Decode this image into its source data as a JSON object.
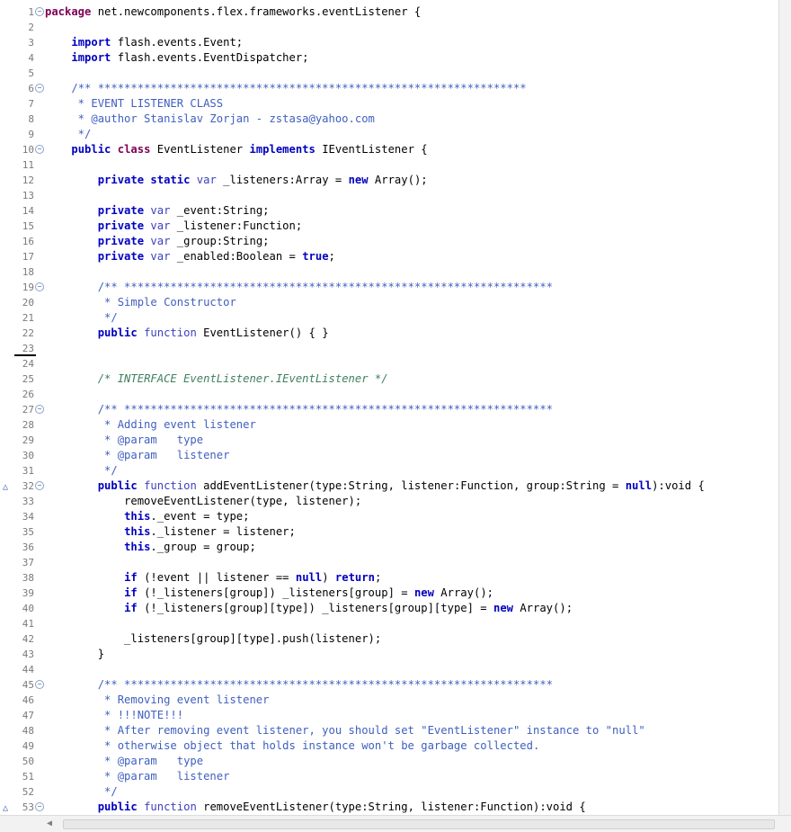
{
  "editor": {
    "lines": [
      {
        "n": "1",
        "fold": true,
        "t": [
          {
            "s": "package",
            "c": "kw"
          },
          {
            "s": " net.newcomponents.flex.frameworks.eventListener {"
          }
        ]
      },
      {
        "n": "2",
        "t": []
      },
      {
        "n": "3",
        "t": [
          {
            "s": "    "
          },
          {
            "s": "import",
            "c": "kb"
          },
          {
            "s": " flash.events.Event;"
          }
        ]
      },
      {
        "n": "4",
        "t": [
          {
            "s": "    "
          },
          {
            "s": "import",
            "c": "kb"
          },
          {
            "s": " flash.events.EventDispatcher;"
          }
        ]
      },
      {
        "n": "5",
        "t": []
      },
      {
        "n": "6",
        "fold": true,
        "t": [
          {
            "s": "    "
          },
          {
            "s": "/** *****************************************************************",
            "c": "cm"
          }
        ]
      },
      {
        "n": "7",
        "t": [
          {
            "s": "     * EVENT LISTENER CLASS",
            "c": "cm"
          }
        ]
      },
      {
        "n": "8",
        "t": [
          {
            "s": "     * @author Stanislav Zorjan - zstasa@yahoo.com",
            "c": "cm"
          }
        ]
      },
      {
        "n": "9",
        "t": [
          {
            "s": "     */",
            "c": "cm"
          }
        ]
      },
      {
        "n": "10",
        "fold": true,
        "t": [
          {
            "s": "    "
          },
          {
            "s": "public",
            "c": "kb"
          },
          {
            "s": " "
          },
          {
            "s": "class",
            "c": "kw"
          },
          {
            "s": " EventListener "
          },
          {
            "s": "implements",
            "c": "kb"
          },
          {
            "s": " IEventListener {"
          }
        ]
      },
      {
        "n": "11",
        "t": []
      },
      {
        "n": "12",
        "t": [
          {
            "s": "        "
          },
          {
            "s": "private",
            "c": "kb"
          },
          {
            "s": " "
          },
          {
            "s": "static",
            "c": "kb"
          },
          {
            "s": " "
          },
          {
            "s": "var",
            "c": "ty"
          },
          {
            "s": " _listeners:Array = "
          },
          {
            "s": "new",
            "c": "kb"
          },
          {
            "s": " Array();"
          }
        ]
      },
      {
        "n": "13",
        "t": []
      },
      {
        "n": "14",
        "t": [
          {
            "s": "        "
          },
          {
            "s": "private",
            "c": "kb"
          },
          {
            "s": " "
          },
          {
            "s": "var",
            "c": "ty"
          },
          {
            "s": " _event:String;"
          }
        ]
      },
      {
        "n": "15",
        "t": [
          {
            "s": "        "
          },
          {
            "s": "private",
            "c": "kb"
          },
          {
            "s": " "
          },
          {
            "s": "var",
            "c": "ty"
          },
          {
            "s": " _listener:Function;"
          }
        ]
      },
      {
        "n": "16",
        "t": [
          {
            "s": "        "
          },
          {
            "s": "private",
            "c": "kb"
          },
          {
            "s": " "
          },
          {
            "s": "var",
            "c": "ty"
          },
          {
            "s": " _group:String;"
          }
        ]
      },
      {
        "n": "17",
        "t": [
          {
            "s": "        "
          },
          {
            "s": "private",
            "c": "kb"
          },
          {
            "s": " "
          },
          {
            "s": "var",
            "c": "ty"
          },
          {
            "s": " _enabled:Boolean = "
          },
          {
            "s": "true",
            "c": "kb"
          },
          {
            "s": ";"
          }
        ]
      },
      {
        "n": "18",
        "t": []
      },
      {
        "n": "19",
        "fold": true,
        "t": [
          {
            "s": "        "
          },
          {
            "s": "/** *****************************************************************",
            "c": "cm"
          }
        ]
      },
      {
        "n": "20",
        "t": [
          {
            "s": "         * Simple Constructor",
            "c": "cm"
          }
        ]
      },
      {
        "n": "21",
        "t": [
          {
            "s": "         */",
            "c": "cm"
          }
        ]
      },
      {
        "n": "22",
        "t": [
          {
            "s": "        "
          },
          {
            "s": "public",
            "c": "kb"
          },
          {
            "s": " "
          },
          {
            "s": "function",
            "c": "ty"
          },
          {
            "s": " EventListener() { }"
          }
        ]
      },
      {
        "n": "23",
        "t": []
      },
      {
        "n": "24",
        "cursor": true,
        "t": []
      },
      {
        "n": "25",
        "t": [
          {
            "s": "        "
          },
          {
            "s": "/* INTERFACE EventListener.IEventListener */",
            "c": "cg"
          }
        ]
      },
      {
        "n": "26",
        "t": []
      },
      {
        "n": "27",
        "fold": true,
        "t": [
          {
            "s": "        "
          },
          {
            "s": "/** *****************************************************************",
            "c": "cm"
          }
        ]
      },
      {
        "n": "28",
        "t": [
          {
            "s": "         * Adding event listener",
            "c": "cm"
          }
        ]
      },
      {
        "n": "29",
        "t": [
          {
            "s": "         * @param   type",
            "c": "cm"
          }
        ]
      },
      {
        "n": "30",
        "t": [
          {
            "s": "         * @param   listener",
            "c": "cm"
          }
        ]
      },
      {
        "n": "31",
        "t": [
          {
            "s": "         */",
            "c": "cm"
          }
        ]
      },
      {
        "n": "32",
        "fold": true,
        "override": true,
        "t": [
          {
            "s": "        "
          },
          {
            "s": "public",
            "c": "kb"
          },
          {
            "s": " "
          },
          {
            "s": "function",
            "c": "ty"
          },
          {
            "s": " addEventListener(type:String, listener:Function, group:String = "
          },
          {
            "s": "null",
            "c": "kb"
          },
          {
            "s": "):void {"
          }
        ]
      },
      {
        "n": "33",
        "t": [
          {
            "s": "            removeEventListener(type, listener);"
          }
        ]
      },
      {
        "n": "34",
        "t": [
          {
            "s": "            "
          },
          {
            "s": "this",
            "c": "kb"
          },
          {
            "s": "._event = type;"
          }
        ]
      },
      {
        "n": "35",
        "t": [
          {
            "s": "            "
          },
          {
            "s": "this",
            "c": "kb"
          },
          {
            "s": "._listener = listener;"
          }
        ]
      },
      {
        "n": "36",
        "t": [
          {
            "s": "            "
          },
          {
            "s": "this",
            "c": "kb"
          },
          {
            "s": "._group = group;"
          }
        ]
      },
      {
        "n": "37",
        "t": []
      },
      {
        "n": "38",
        "t": [
          {
            "s": "            "
          },
          {
            "s": "if",
            "c": "kb"
          },
          {
            "s": " (!event || listener == "
          },
          {
            "s": "null",
            "c": "kb"
          },
          {
            "s": ") "
          },
          {
            "s": "return",
            "c": "kb"
          },
          {
            "s": ";"
          }
        ]
      },
      {
        "n": "39",
        "t": [
          {
            "s": "            "
          },
          {
            "s": "if",
            "c": "kb"
          },
          {
            "s": " (!_listeners[group]) _listeners[group] = "
          },
          {
            "s": "new",
            "c": "kb"
          },
          {
            "s": " Array();"
          }
        ]
      },
      {
        "n": "40",
        "t": [
          {
            "s": "            "
          },
          {
            "s": "if",
            "c": "kb"
          },
          {
            "s": " (!_listeners[group][type]) _listeners[group][type] = "
          },
          {
            "s": "new",
            "c": "kb"
          },
          {
            "s": " Array();"
          }
        ]
      },
      {
        "n": "41",
        "t": []
      },
      {
        "n": "42",
        "t": [
          {
            "s": "            _listeners[group][type].push(listener);"
          }
        ]
      },
      {
        "n": "43",
        "t": [
          {
            "s": "        }"
          }
        ]
      },
      {
        "n": "44",
        "t": []
      },
      {
        "n": "45",
        "fold": true,
        "t": [
          {
            "s": "        "
          },
          {
            "s": "/** *****************************************************************",
            "c": "cm"
          }
        ]
      },
      {
        "n": "46",
        "t": [
          {
            "s": "         * Removing event listener",
            "c": "cm"
          }
        ]
      },
      {
        "n": "47",
        "t": [
          {
            "s": "         * !!!NOTE!!!",
            "c": "cm"
          }
        ]
      },
      {
        "n": "48",
        "t": [
          {
            "s": "         * After removing event listener, you should set \"EventListener\" instance to \"null\"",
            "c": "cm"
          }
        ]
      },
      {
        "n": "49",
        "t": [
          {
            "s": "         * otherwise object that holds instance won't be garbage collected.",
            "c": "cm"
          }
        ]
      },
      {
        "n": "50",
        "t": [
          {
            "s": "         * @param   type",
            "c": "cm"
          }
        ]
      },
      {
        "n": "51",
        "t": [
          {
            "s": "         * @param   listener",
            "c": "cm"
          }
        ]
      },
      {
        "n": "52",
        "t": [
          {
            "s": "         */",
            "c": "cm"
          }
        ]
      },
      {
        "n": "53",
        "fold": true,
        "override": true,
        "t": [
          {
            "s": "        "
          },
          {
            "s": "public",
            "c": "kb"
          },
          {
            "s": " "
          },
          {
            "s": "function",
            "c": "ty"
          },
          {
            "s": " removeEventListener(type:String, listener:Function):void {"
          }
        ]
      }
    ]
  },
  "icons": {
    "fold": "collapse-fold-icon",
    "override": "override-marker-icon",
    "scroll_left": "scroll-left-arrow-icon"
  },
  "colors": {
    "keyword_purple": "#7f0055",
    "keyword_blue": "#0000c0",
    "type_blue": "#3f3fbf",
    "doc_comment": "#3f5fbf",
    "comment_green": "#3f7f5f",
    "line_number": "#7a7a7a"
  }
}
